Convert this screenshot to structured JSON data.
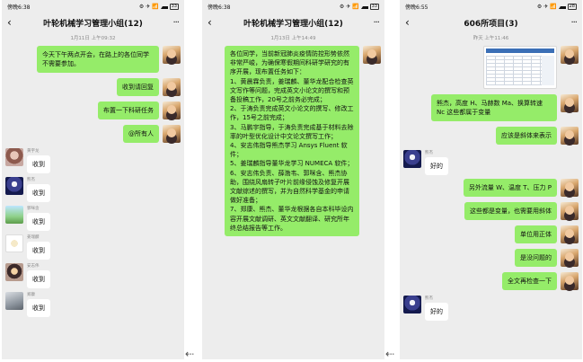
{
  "phones": [
    {
      "status": {
        "time": "傍晚6:38",
        "icons": "⚙ ✈ 📶",
        "battery": "33"
      },
      "title": "叶轮机械学习管理小组(12)",
      "timestamp": "1月11日 上午09:32",
      "messages_right": [
        "今天下午两点开会，在路上的各位同学不需要参加。",
        "收到请回复",
        "布置一下科研任务",
        "@所有人"
      ],
      "messages_left": [
        {
          "sender": "黄宇龙",
          "text": "收到"
        },
        {
          "sender": "熊杰",
          "text": "收到"
        },
        {
          "sender": "郭咪含",
          "text": "收到"
        },
        {
          "sender": "姜瑞麟",
          "text": "收到"
        },
        {
          "sender": "安志伟",
          "text": "收到"
        },
        {
          "sender": "郑康",
          "text": "收到"
        }
      ]
    },
    {
      "status": {
        "time": "傍晚6:38",
        "icons": "⚙ ✈ 📶",
        "battery": "33"
      },
      "title": "叶轮机械学习管理小组(12)",
      "timestamp": "1月13日 上午14:49",
      "long_message": [
        "各位同学，当前新冠肺炎疫情防控形势依然非常严峻，为确保寒假期间科研学研究的有序开展，现布置任务如下：",
        "1、黄晨霖负责，姜瑞麟、董华龙配合检查英文写作等问题，完成英文小论文的撰写和预备投稿工作，20号之前务必完成；",
        "2、于涛负责完成英文小论文的撰写、修改工作，15号之前完成；",
        "3、马鹏宇指导，于涛负责完成基于材料去除率的叶型优化设计中文论文撰写工作；",
        "4、安志伟指导熊杰学习 Ansys Fluent 软件；",
        "5、姜瑞麟指导董华龙学习 NUMECA 软件；",
        "6、安志伟负责、薛渤韦、郭咪含、熊杰协助，围绕风扇转子叶片前缘侵蚀及修复开展文献综述的撰写，并为自然科学基金的申请做好准备；",
        "7、郑康、熊杰、董华龙根据各自本科毕设内容开展文献调研、英文文献翻译、研究所年终总结报告等工作。"
      ]
    },
    {
      "status": {
        "time": "傍晚6:55",
        "icons": "⚙ ✈ 📶",
        "battery": "28"
      },
      "title": "606所项目(3)",
      "timestamp": "昨天 上午11:46",
      "messages": [
        {
          "side": "right",
          "kind": "image"
        },
        {
          "side": "right",
          "text": "熊杰，高度 H、马赫数 Ma、换算转速 Nc 这些都属于变量"
        },
        {
          "side": "right",
          "text": "应该是斜体来表示"
        },
        {
          "side": "left",
          "sender": "熊杰",
          "text": "好的"
        },
        {
          "side": "right",
          "text": "另外流量 W、温度 T、压力 P"
        },
        {
          "side": "right",
          "text": "这些都是变量，也需要用斜体"
        },
        {
          "side": "right",
          "text": "单位用正体"
        },
        {
          "side": "right",
          "text": "是没问题的"
        },
        {
          "side": "right",
          "text": "全文再检查一下"
        },
        {
          "side": "left",
          "sender": "熊杰",
          "text": "好的"
        }
      ]
    }
  ],
  "icons": {
    "back": "back-arrow-icon",
    "more": "more-dots-icon",
    "avatar": "avatar"
  },
  "colors": {
    "bg": "#ededed",
    "bubble_self": "#95ec69",
    "bubble_other": "#ffffff"
  }
}
